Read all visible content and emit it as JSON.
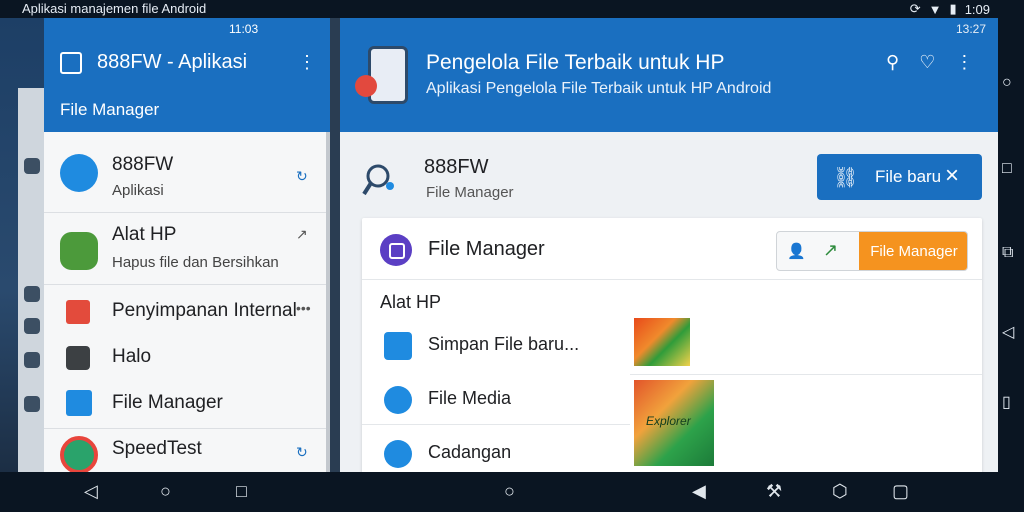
{
  "status_bar": {
    "title": "Aplikasi manajemen file Android",
    "time": "1:09"
  },
  "left_panel": {
    "status_time": "11:03",
    "header_title": "888FW - Aplikasi",
    "header_subtitle": "File Manager",
    "items": [
      {
        "title": "888FW",
        "subtitle": "Aplikasi"
      },
      {
        "title": "Alat HP",
        "subtitle": "Hapus file dan Bersihkan"
      },
      {
        "title": "Penyimpanan Internal"
      },
      {
        "title": "Halo"
      },
      {
        "title": "File Manager"
      },
      {
        "title": "SpeedTest"
      }
    ]
  },
  "main": {
    "status_time": "13:27",
    "title": "Pengelola File Terbaik untuk HP",
    "subtitle": "Aplikasi Pengelola File Terbaik untuk HP Android",
    "search_title": "888FW",
    "search_subtitle": "File Manager",
    "button_label": "File baru",
    "card": {
      "app_name": "File Manager",
      "cta_label": "File Manager",
      "section_title": "Alat HP",
      "rows": [
        {
          "title": "Simpan File baru..."
        },
        {
          "title": "File Media"
        },
        {
          "title": "Cadangan"
        }
      ],
      "thumb_caption": "Explorer"
    }
  },
  "colors": {
    "primary": "#1a6fc0",
    "accent": "#f5931f"
  }
}
